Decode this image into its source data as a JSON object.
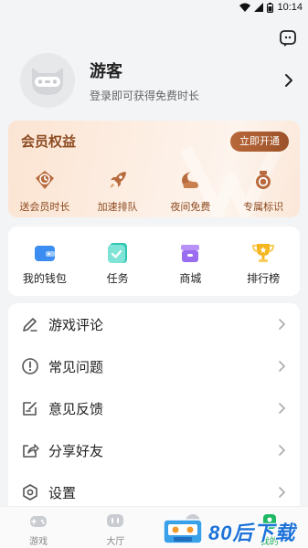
{
  "status_bar": {
    "time": "10:14"
  },
  "profile": {
    "name": "游客",
    "subtitle": "登录即可获得免费时长"
  },
  "vip": {
    "title": "会员权益",
    "open_label": "立即开通",
    "items": [
      {
        "label": "送会员时长",
        "icon": "clock-icon"
      },
      {
        "label": "加速排队",
        "icon": "rocket-icon"
      },
      {
        "label": "夜间免费",
        "icon": "moon-icon"
      },
      {
        "label": "专属标识",
        "icon": "badge-icon"
      }
    ]
  },
  "tools": [
    {
      "label": "我的钱包",
      "icon": "wallet-icon",
      "color": "#3b8df2"
    },
    {
      "label": "任务",
      "icon": "task-icon",
      "color": "#2fc6b4"
    },
    {
      "label": "商城",
      "icon": "shop-icon",
      "color": "#9a6cf0"
    },
    {
      "label": "排行榜",
      "icon": "trophy-icon",
      "color": "#f5b51e"
    }
  ],
  "menu": [
    {
      "label": "游戏评论",
      "icon": "pencil-icon"
    },
    {
      "label": "常见问题",
      "icon": "alert-icon"
    },
    {
      "label": "意见反馈",
      "icon": "feedback-icon"
    },
    {
      "label": "分享好友",
      "icon": "share-icon"
    },
    {
      "label": "设置",
      "icon": "settings-icon"
    }
  ],
  "tabs": [
    {
      "label": "游戏",
      "icon": "gamepad-icon"
    },
    {
      "label": "大厅",
      "icon": "lobby-icon"
    },
    {
      "label": "",
      "icon": "center-icon"
    },
    {
      "label": "我的",
      "icon": "me-icon",
      "active": true
    }
  ],
  "watermark": {
    "text": "80后下载"
  }
}
